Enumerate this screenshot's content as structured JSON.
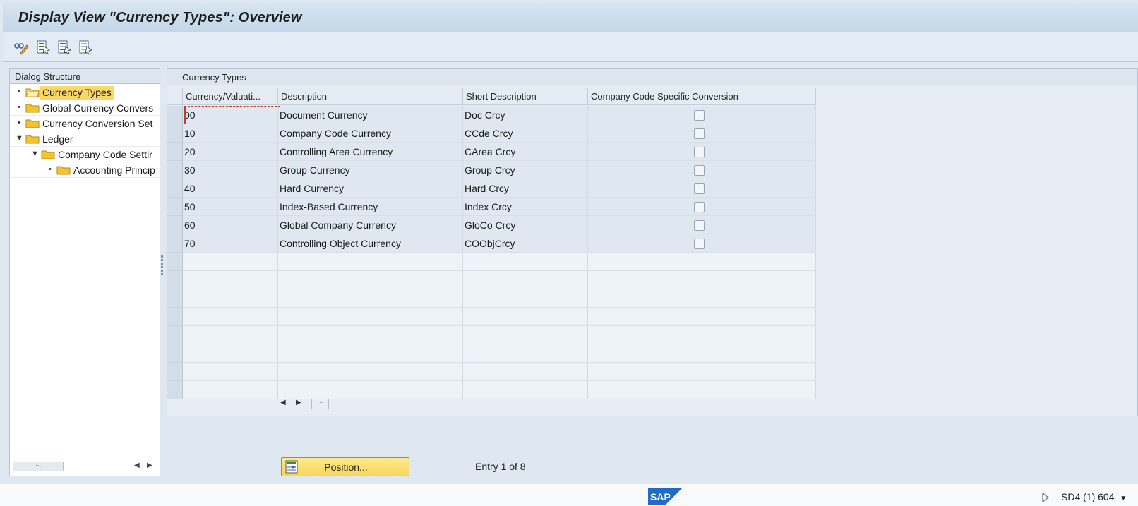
{
  "window": {
    "title": "Display View \"Currency Types\": Overview"
  },
  "toolbar": {
    "buttons": [
      {
        "icon": "glasses-pencil-icon"
      },
      {
        "icon": "select-all-icon"
      },
      {
        "icon": "select-block-icon"
      },
      {
        "icon": "deselect-all-icon"
      }
    ]
  },
  "dialog_structure": {
    "header": "Dialog Structure",
    "items": [
      {
        "label": "Currency Types",
        "level": 0,
        "marker": "•",
        "selected": true
      },
      {
        "label": "Global Currency Convers",
        "level": 0,
        "marker": "•",
        "selected": false
      },
      {
        "label": "Currency Conversion Set",
        "level": 0,
        "marker": "•",
        "selected": false
      },
      {
        "label": "Ledger",
        "level": 0,
        "marker": "▼",
        "selected": false
      },
      {
        "label": "Company Code Settir",
        "level": 1,
        "marker": "▼",
        "selected": false
      },
      {
        "label": "Accounting Princip",
        "level": 2,
        "marker": "•",
        "selected": false
      }
    ]
  },
  "currency_types": {
    "header": "Currency Types",
    "columns": [
      "Currency/Valuati...",
      "Description",
      "Short Description",
      "Company Code Specific Conversion"
    ],
    "rows": [
      {
        "code": "00",
        "description": "Document Currency",
        "short": "Doc Crcy",
        "cc_specific": false
      },
      {
        "code": "10",
        "description": "Company Code Currency",
        "short": "CCde Crcy",
        "cc_specific": false
      },
      {
        "code": "20",
        "description": "Controlling Area Currency",
        "short": "CArea Crcy",
        "cc_specific": false
      },
      {
        "code": "30",
        "description": "Group Currency",
        "short": "Group Crcy",
        "cc_specific": false
      },
      {
        "code": "40",
        "description": "Hard Currency",
        "short": "Hard Crcy",
        "cc_specific": false
      },
      {
        "code": "50",
        "description": "Index-Based Currency",
        "short": "Index Crcy",
        "cc_specific": false
      },
      {
        "code": "60",
        "description": "Global Company Currency",
        "short": "GloCo Crcy",
        "cc_specific": false
      },
      {
        "code": "70",
        "description": "Controlling Object Currency",
        "short": "COObjCrcy",
        "cc_specific": false
      }
    ]
  },
  "footer": {
    "position_button": "Position...",
    "entry_info": "Entry 1 of 8"
  },
  "status": {
    "system": "SD4 (1) 604"
  },
  "colors": {
    "selected_tree": "#fbd768",
    "position_button": "#f7d75a",
    "sap_blue": "#1f6bc7"
  }
}
